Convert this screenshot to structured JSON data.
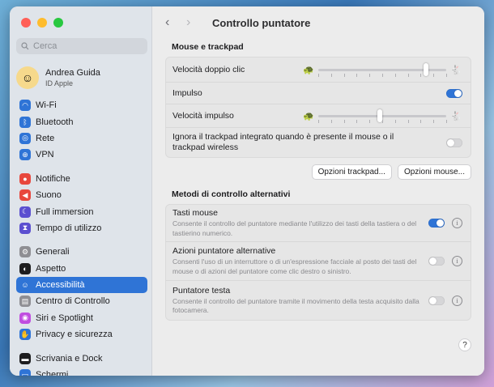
{
  "window": {
    "title": "Controllo puntatore"
  },
  "colors": {
    "accent": "#2f74d6",
    "close": "#ff5f57",
    "minimize": "#febc2e",
    "zoom": "#28c840"
  },
  "sidebar": {
    "search_placeholder": "Cerca",
    "user": {
      "name": "Andrea Guida",
      "subtitle": "ID Apple"
    },
    "groups": [
      [
        {
          "label": "Wi-Fi",
          "icon": "wifi-icon",
          "color": "#2f74d6",
          "glyph": "◠"
        },
        {
          "label": "Bluetooth",
          "icon": "bluetooth-icon",
          "color": "#2f74d6",
          "glyph": "ᛒ"
        },
        {
          "label": "Rete",
          "icon": "network-icon",
          "color": "#2f74d6",
          "glyph": "◎"
        },
        {
          "label": "VPN",
          "icon": "vpn-icon",
          "color": "#2f74d6",
          "glyph": "⊕"
        }
      ],
      [
        {
          "label": "Notifiche",
          "icon": "bell-icon",
          "color": "#e8473d",
          "glyph": "●"
        },
        {
          "label": "Suono",
          "icon": "speaker-icon",
          "color": "#e8473d",
          "glyph": "◀"
        },
        {
          "label": "Full immersion",
          "icon": "moon-icon",
          "color": "#5b4fd0",
          "glyph": "☾"
        },
        {
          "label": "Tempo di utilizzo",
          "icon": "hourglass-icon",
          "color": "#5b4fd0",
          "glyph": "⧗"
        }
      ],
      [
        {
          "label": "Generali",
          "icon": "gear-icon",
          "color": "#8e8e93",
          "glyph": "⚙"
        },
        {
          "label": "Aspetto",
          "icon": "appearance-icon",
          "color": "#1d1d1f",
          "glyph": "◐"
        },
        {
          "label": "Accessibilità",
          "icon": "accessibility-icon",
          "color": "#2f74d6",
          "glyph": "☺",
          "active": true
        },
        {
          "label": "Centro di Controllo",
          "icon": "control-center-icon",
          "color": "#8e8e93",
          "glyph": "▤"
        },
        {
          "label": "Siri e Spotlight",
          "icon": "siri-icon",
          "color": "#c04de0",
          "glyph": "◉"
        },
        {
          "label": "Privacy e sicurezza",
          "icon": "hand-icon",
          "color": "#2f74d6",
          "glyph": "✋"
        }
      ],
      [
        {
          "label": "Scrivania e Dock",
          "icon": "dock-icon",
          "color": "#1d1d1f",
          "glyph": "▬"
        },
        {
          "label": "Schermi",
          "icon": "display-icon",
          "color": "#2f74d6",
          "glyph": "▭"
        }
      ]
    ]
  },
  "main": {
    "section1": {
      "title": "Mouse e trackpad",
      "double_click": {
        "label": "Velocità doppio clic",
        "value": 0.84
      },
      "impulse": {
        "label": "Impulso",
        "on": true
      },
      "impulse_speed": {
        "label": "Velocità impulso",
        "value": 0.48
      },
      "ignore_trackpad": {
        "label": "Ignora il trackpad integrato quando è presente il mouse o il trackpad wireless",
        "on": false
      }
    },
    "buttons": {
      "trackpad": "Opzioni trackpad...",
      "mouse": "Opzioni mouse..."
    },
    "section2": {
      "title": "Metodi di controllo alternativi",
      "items": [
        {
          "label": "Tasti mouse",
          "desc": "Consente il controllo del puntatore mediante l'utilizzo dei tasti della tastiera o del tastierino numerico.",
          "on": true
        },
        {
          "label": "Azioni puntatore alternative",
          "desc": "Consenti l'uso di un interruttore o di un'espressione facciale al posto dei tasti del mouse o di azioni del puntatore come clic destro o sinistro.",
          "on": false
        },
        {
          "label": "Puntatore testa",
          "desc": "Consente il controllo del puntatore tramite il movimento della testa acquisito dalla fotocamera.",
          "on": false
        }
      ]
    },
    "help_label": "?"
  }
}
